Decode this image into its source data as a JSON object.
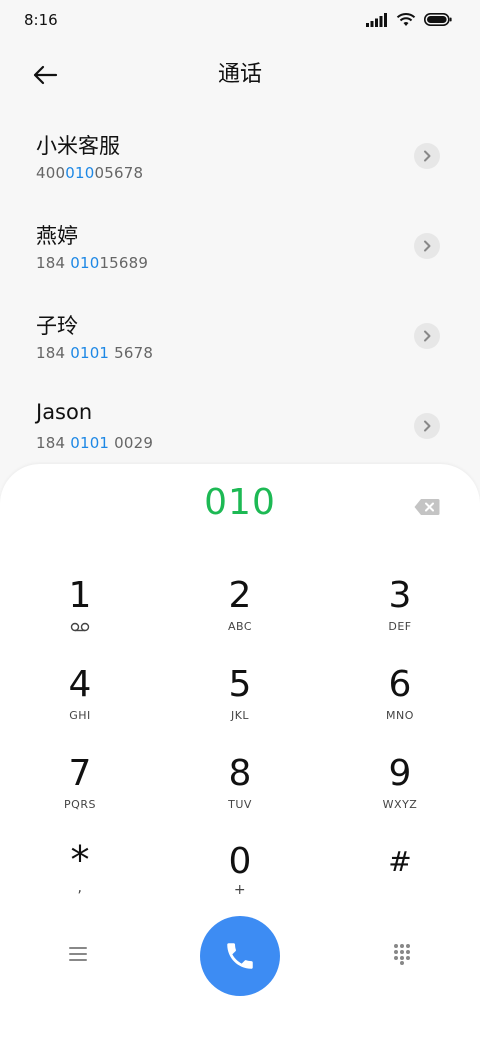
{
  "status": {
    "time": "8:16"
  },
  "header": {
    "title": "通话"
  },
  "contacts": [
    {
      "name": "小米客服",
      "num_pre": "400",
      "num_hl": "010",
      "num_post": "05678"
    },
    {
      "name": "燕婷",
      "num_pre": "184 ",
      "num_hl": "010",
      "num_post": "15689"
    },
    {
      "name": "子玲",
      "num_pre": "184 ",
      "num_hl": "0101",
      "num_post": " 5678"
    },
    {
      "name": "Jason",
      "num_pre": "184 ",
      "num_hl": "0101",
      "num_post": " 0029"
    }
  ],
  "dialpad": {
    "entered": "010",
    "keys": [
      {
        "digit": "1",
        "letters": ""
      },
      {
        "digit": "2",
        "letters": "ABC"
      },
      {
        "digit": "3",
        "letters": "DEF"
      },
      {
        "digit": "4",
        "letters": "GHI"
      },
      {
        "digit": "5",
        "letters": "JKL"
      },
      {
        "digit": "6",
        "letters": "MNO"
      },
      {
        "digit": "7",
        "letters": "PQRS"
      },
      {
        "digit": "8",
        "letters": "TUV"
      },
      {
        "digit": "9",
        "letters": "WXYZ"
      },
      {
        "digit": "*",
        "letters": ","
      },
      {
        "digit": "0",
        "letters": "+"
      },
      {
        "digit": "#",
        "letters": ""
      }
    ]
  },
  "colors": {
    "accent_green": "#1db954",
    "highlight_blue": "#1e88e5",
    "call_button": "#3d8cf3"
  },
  "icons": {
    "back": "arrow-left-icon",
    "delete": "backspace-icon",
    "voicemail": "voicemail-icon",
    "menu": "menu-icon",
    "call": "phone-icon",
    "dialpad_toggle": "dialpad-grid-icon"
  }
}
